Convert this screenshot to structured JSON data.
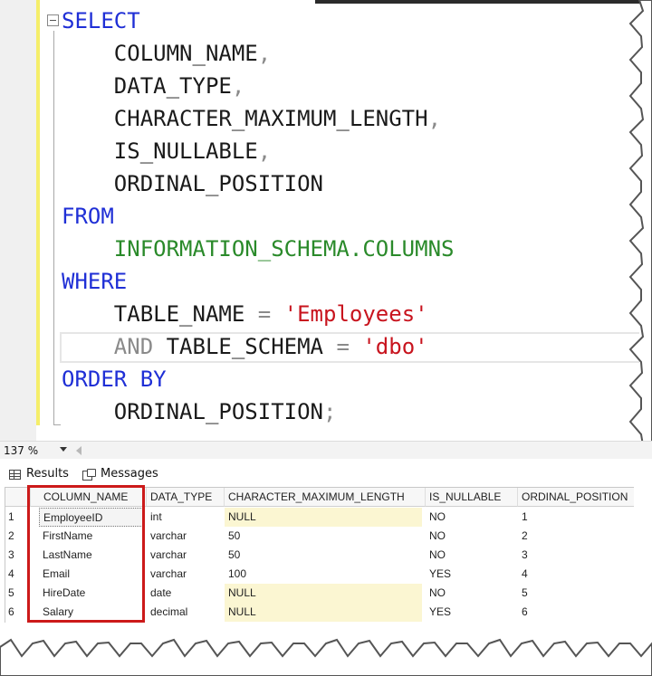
{
  "editor": {
    "lines": [
      {
        "parts": [
          {
            "t": "SELECT",
            "c": "kw"
          }
        ]
      },
      {
        "parts": [
          {
            "t": "    COLUMN_NAME",
            "c": "plain"
          },
          {
            "t": ",",
            "c": "op"
          }
        ]
      },
      {
        "parts": [
          {
            "t": "    DATA_TYPE",
            "c": "plain"
          },
          {
            "t": ",",
            "c": "op"
          }
        ]
      },
      {
        "parts": [
          {
            "t": "    CHARACTER_MAXIMUM_LENGTH",
            "c": "plain"
          },
          {
            "t": ",",
            "c": "op"
          }
        ]
      },
      {
        "parts": [
          {
            "t": "    IS_NULLABLE",
            "c": "plain"
          },
          {
            "t": ",",
            "c": "op"
          }
        ]
      },
      {
        "parts": [
          {
            "t": "    ORDINAL_POSITION",
            "c": "plain"
          }
        ]
      },
      {
        "parts": [
          {
            "t": "FROM",
            "c": "kw"
          }
        ]
      },
      {
        "parts": [
          {
            "t": "    INFORMATION_SCHEMA.COLUMNS",
            "c": "fn"
          }
        ]
      },
      {
        "parts": [
          {
            "t": "WHERE",
            "c": "kw"
          }
        ]
      },
      {
        "parts": [
          {
            "t": "    TABLE_NAME ",
            "c": "plain"
          },
          {
            "t": "=",
            "c": "op"
          },
          {
            "t": " ",
            "c": "plain"
          },
          {
            "t": "'Employees'",
            "c": "str"
          }
        ]
      },
      {
        "parts": [
          {
            "t": "    ",
            "c": "plain"
          },
          {
            "t": "AND",
            "c": "op"
          },
          {
            "t": " TABLE_SCHEMA ",
            "c": "plain"
          },
          {
            "t": "=",
            "c": "op"
          },
          {
            "t": " ",
            "c": "plain"
          },
          {
            "t": "'dbo'",
            "c": "str"
          }
        ]
      },
      {
        "parts": [
          {
            "t": "ORDER BY",
            "c": "kw"
          }
        ]
      },
      {
        "parts": [
          {
            "t": "    ORDINAL_POSITION",
            "c": "plain"
          },
          {
            "t": ";",
            "c": "op"
          }
        ]
      }
    ]
  },
  "statusbar": {
    "zoom": "137 %"
  },
  "results": {
    "tabs": {
      "results_label": "Results",
      "messages_label": "Messages"
    },
    "columns": [
      "COLUMN_NAME",
      "DATA_TYPE",
      "CHARACTER_MAXIMUM_LENGTH",
      "IS_NULLABLE",
      "ORDINAL_POSITION"
    ],
    "rows": [
      {
        "n": "1",
        "cells": [
          "EmployeeID",
          "int",
          "NULL",
          "NO",
          "1"
        ]
      },
      {
        "n": "2",
        "cells": [
          "FirstName",
          "varchar",
          "50",
          "NO",
          "2"
        ]
      },
      {
        "n": "3",
        "cells": [
          "LastName",
          "varchar",
          "50",
          "NO",
          "3"
        ]
      },
      {
        "n": "4",
        "cells": [
          "Email",
          "varchar",
          "100",
          "YES",
          "4"
        ]
      },
      {
        "n": "5",
        "cells": [
          "HireDate",
          "date",
          "NULL",
          "NO",
          "5"
        ]
      },
      {
        "n": "6",
        "cells": [
          "Salary",
          "decimal",
          "NULL",
          "YES",
          "6"
        ]
      }
    ]
  },
  "colors": {
    "keyword": "#1f2fd6",
    "function": "#2a8a2a",
    "string": "#c8141e",
    "operator": "#8a8a8a",
    "highlight_box": "#cc1a1a",
    "null_cell": "#fbf6d2"
  }
}
